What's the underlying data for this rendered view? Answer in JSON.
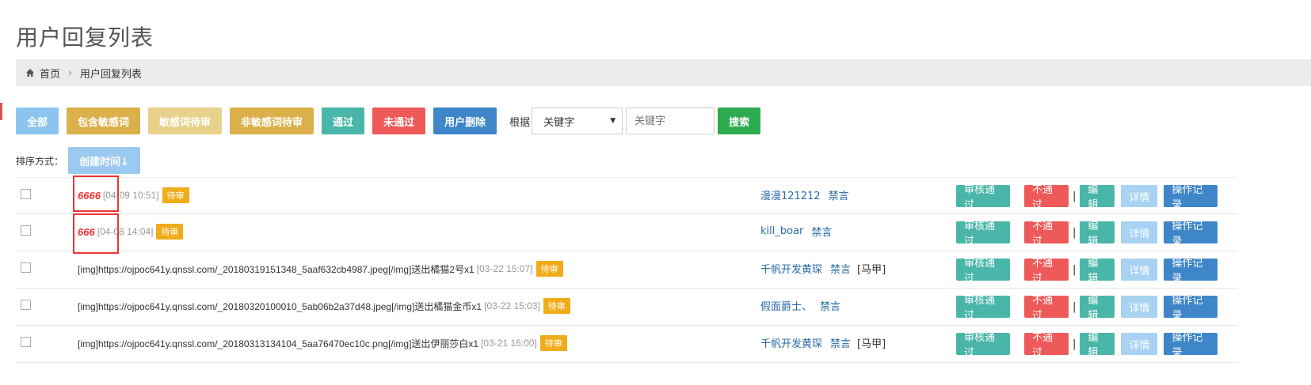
{
  "page": {
    "title": "用户回复列表"
  },
  "breadcrumb": {
    "home": "首页",
    "current": "用户回复列表"
  },
  "filters": {
    "all": "全部",
    "contains_sensitive": "包含敏感词",
    "sensitive_pending": "敏感词待审",
    "non_sensitive_pending": "非敏感词待审",
    "passed": "通过",
    "not_passed": "未通过",
    "user_deleted": "用户删除"
  },
  "search": {
    "by_label": "根据",
    "field_selected": "关键字",
    "keyword_placeholder": "关键字",
    "search_label": "搜索"
  },
  "sort": {
    "label": "排序方式：",
    "button": "创建时间↓"
  },
  "actions": {
    "approve": "审核通过",
    "reject": "不通过",
    "separator": "|",
    "edit": "编辑",
    "detail": "详情",
    "log": "操作记录"
  },
  "rows": [
    {
      "text": "6666",
      "time": "[04-09 10:51]",
      "badge": "待审",
      "user": "漫漫121212",
      "ban": "禁言",
      "tag": ""
    },
    {
      "text": "666",
      "time": "[04-08 14:04]",
      "badge": "待审",
      "user": "kill_boar",
      "ban": "禁言",
      "tag": ""
    },
    {
      "text": "[img]https://ojpoc641y.qnssl.com/_20180319151348_5aaf632cb4987.jpeg[/img]送出橘猫2号x1",
      "time": "[03-22 15:07]",
      "badge": "待审",
      "user": "千帆开发黄琛",
      "ban": "禁言",
      "tag": "[马甲]"
    },
    {
      "text": "[img]https://ojpoc641y.qnssl.com/_20180320100010_5ab06b2a37d48.jpeg[/img]送出橘猫金币x1",
      "time": "[03-22 15:03]",
      "badge": "待审",
      "user": "假面爵士、",
      "ban": "禁言",
      "tag": ""
    },
    {
      "text": "[img]https://ojpoc641y.qnssl.com/_20180313134104_5aa76470ec10c.png[/img]送出伊丽莎白x1",
      "time": "[03-21 16:00]",
      "badge": "待审",
      "user": "千帆开发黄琛",
      "ban": "禁言",
      "tag": "[马甲]"
    }
  ],
  "colors": {
    "highlight": "#ee3333",
    "pending_badge": "#f0ad1a",
    "approve": "#49b6a9",
    "reject": "#ee5a5a",
    "primary": "#3f86c9"
  }
}
